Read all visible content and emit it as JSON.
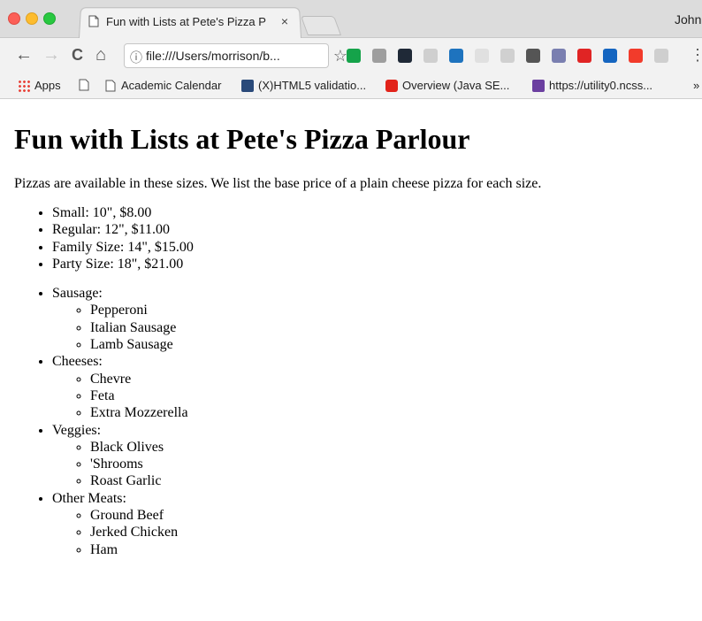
{
  "browser": {
    "tab_title": "Fun with Lists at Pete's Pizza P",
    "tab_close": "×",
    "profile": "John",
    "url": "file:///Users/morrison/b...",
    "nav": {
      "back": "←",
      "forward": "→",
      "reload": "C",
      "home": "⌂",
      "info": "ⓘ",
      "star": "☆"
    },
    "bookmarks": [
      {
        "label": "Apps",
        "icon": "apps-grid-icon"
      },
      {
        "label": "",
        "icon": "page-icon"
      },
      {
        "label": "Academic Calendar",
        "icon": "page-icon"
      },
      {
        "label": "(X)HTML5 validatio...",
        "icon": "validator-icon"
      },
      {
        "label": "Overview (Java SE...",
        "icon": "oracle-icon"
      },
      {
        "label": "https://utility0.ncss...",
        "icon": "site-icon"
      }
    ],
    "bookmarks_overflow": "»",
    "extension_colors": [
      "#15a34a",
      "#9e9e9e",
      "#1f2937",
      "#cfcfcf",
      "#1e73be",
      "#e0e0e0",
      "#d0d0d0",
      "#555555",
      "#7a7fb0",
      "#e02424",
      "#1565c0",
      "#f23b2b",
      "#cfcfcf"
    ]
  },
  "page": {
    "heading": "Fun with Lists at Pete's Pizza Parlour",
    "intro": "Pizzas are available in these sizes. We list the base price of a plain cheese pizza for each size.",
    "sizes": [
      "Small: 10\", $8.00",
      "Regular: 12\", $11.00",
      "Family Size: 14\", $15.00",
      "Party Size: 18\", $21.00"
    ],
    "toppings": [
      {
        "label": "Sausage:",
        "items": [
          "Pepperoni",
          "Italian Sausage",
          "Lamb Sausage"
        ]
      },
      {
        "label": "Cheeses:",
        "items": [
          "Chevre",
          "Feta",
          "Extra Mozzerella"
        ]
      },
      {
        "label": "Veggies:",
        "items": [
          "Black Olives",
          "'Shrooms",
          "Roast Garlic"
        ]
      },
      {
        "label": "Other Meats:",
        "items": [
          "Ground Beef",
          "Jerked Chicken",
          "Ham"
        ]
      }
    ]
  }
}
